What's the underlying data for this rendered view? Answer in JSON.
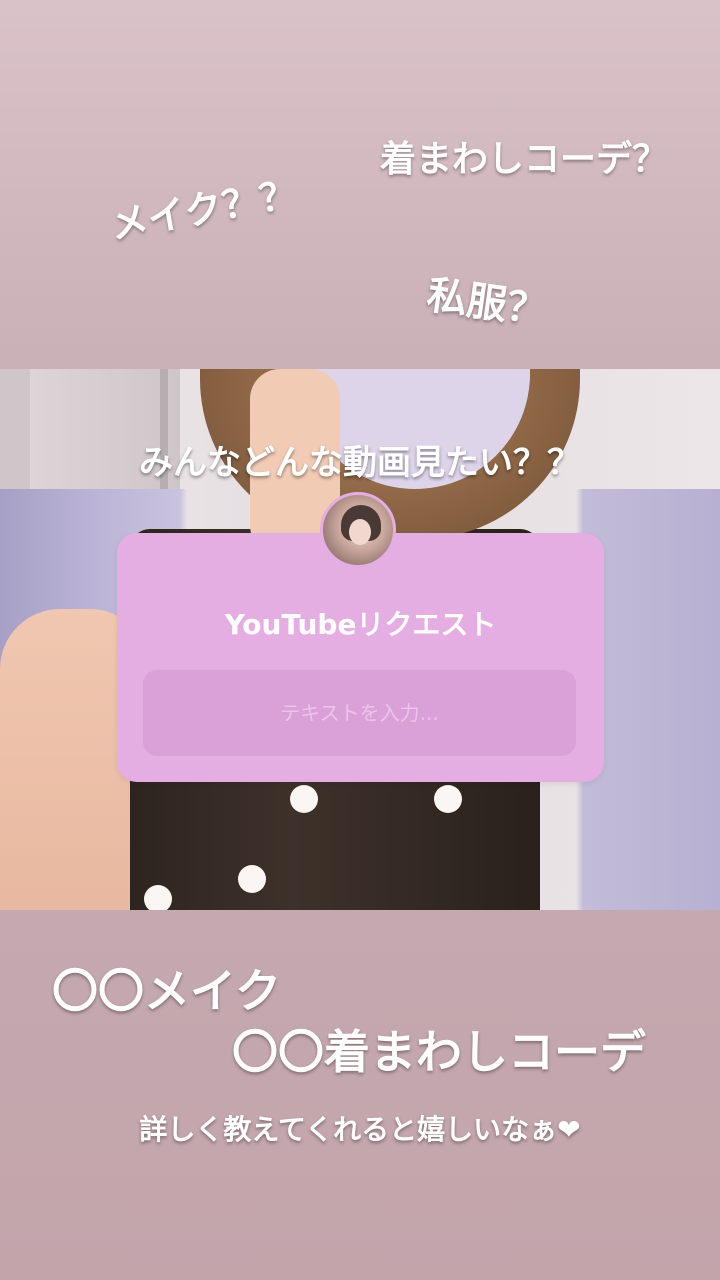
{
  "top_texts": {
    "kigawashi": "着まわしコーデ？",
    "makeup": "メイク？？",
    "shifuku": "私服？"
  },
  "question": {
    "title": "みんなどんな動画見たい？？",
    "sticker_label": "YouTubeリクエスト",
    "input_placeholder": "テキストを入力..."
  },
  "bottom_texts": {
    "line1": "〇〇メイク",
    "line2": "〇〇着まわしコーデ",
    "line3": "詳しく教えてくれると嬉しいなぁ❤"
  },
  "colors": {
    "sticker_bg": "#e5aee3",
    "input_bg": "#d9a1d7",
    "page_bg": "#c9afb6"
  }
}
